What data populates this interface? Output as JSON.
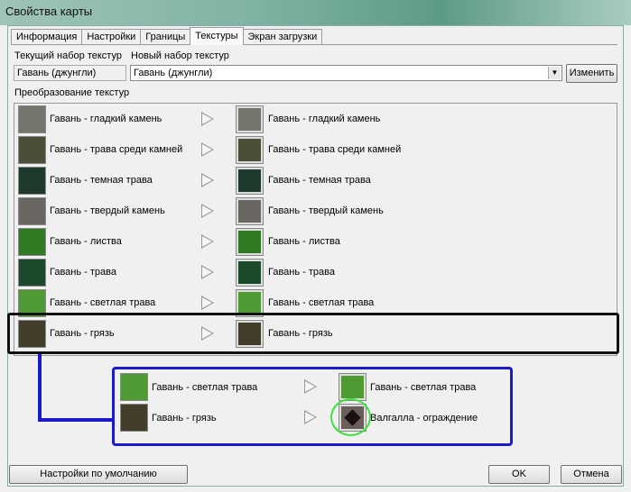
{
  "window": {
    "title": "Свойства карты"
  },
  "tabs": [
    {
      "label": "Информация"
    },
    {
      "label": "Настройки"
    },
    {
      "label": "Границы"
    },
    {
      "label": "Текстуры",
      "active": true
    },
    {
      "label": "Экран загрузки"
    }
  ],
  "texture_set": {
    "current_label": "Текущий набор текстур",
    "new_label": "Новый набор текстур",
    "current_value": "Гавань (джунгли)",
    "new_value": "Гавань (джунгли)",
    "change_button": "Изменить"
  },
  "conversion": {
    "label": "Преобразование текстур",
    "rows": [
      {
        "from": "Гавань - гладкий камень",
        "to": "Гавань - гладкий камень",
        "color": "#75756c"
      },
      {
        "from": "Гавань - трава среди камней",
        "to": "Гавань - трава среди камней",
        "color": "#4a5038"
      },
      {
        "from": "Гавань - темная трава",
        "to": "Гавань - темная трава",
        "color": "#1d3a2c"
      },
      {
        "from": "Гавань - твердый камень",
        "to": "Гавань - твердый камень",
        "color": "#6a6662"
      },
      {
        "from": "Гавань - листва",
        "to": "Гавань - листва",
        "color": "#2f7a22"
      },
      {
        "from": "Гавань - трава",
        "to": "Гавань - трава",
        "color": "#1b4a2a"
      },
      {
        "from": "Гавань - светлая трава",
        "to": "Гавань - светлая трава",
        "color": "#4f9a32"
      },
      {
        "from": "Гавань - грязь",
        "to": "Гавань - грязь",
        "color": "#423c2a"
      }
    ]
  },
  "callout": {
    "rows": [
      {
        "from": "Гавань - светлая трава",
        "to": "Гавань - светлая трава",
        "from_color": "#4f9a32",
        "to_color": "#4f9a32"
      },
      {
        "from": "Гавань - грязь",
        "to": "Валгалла - ограждение",
        "from_color": "#423c2a",
        "to_color": "#6a5e5a"
      }
    ]
  },
  "buttons": {
    "defaults": "Настройки по умолчанию",
    "ok": "OK",
    "cancel": "Отмена"
  }
}
